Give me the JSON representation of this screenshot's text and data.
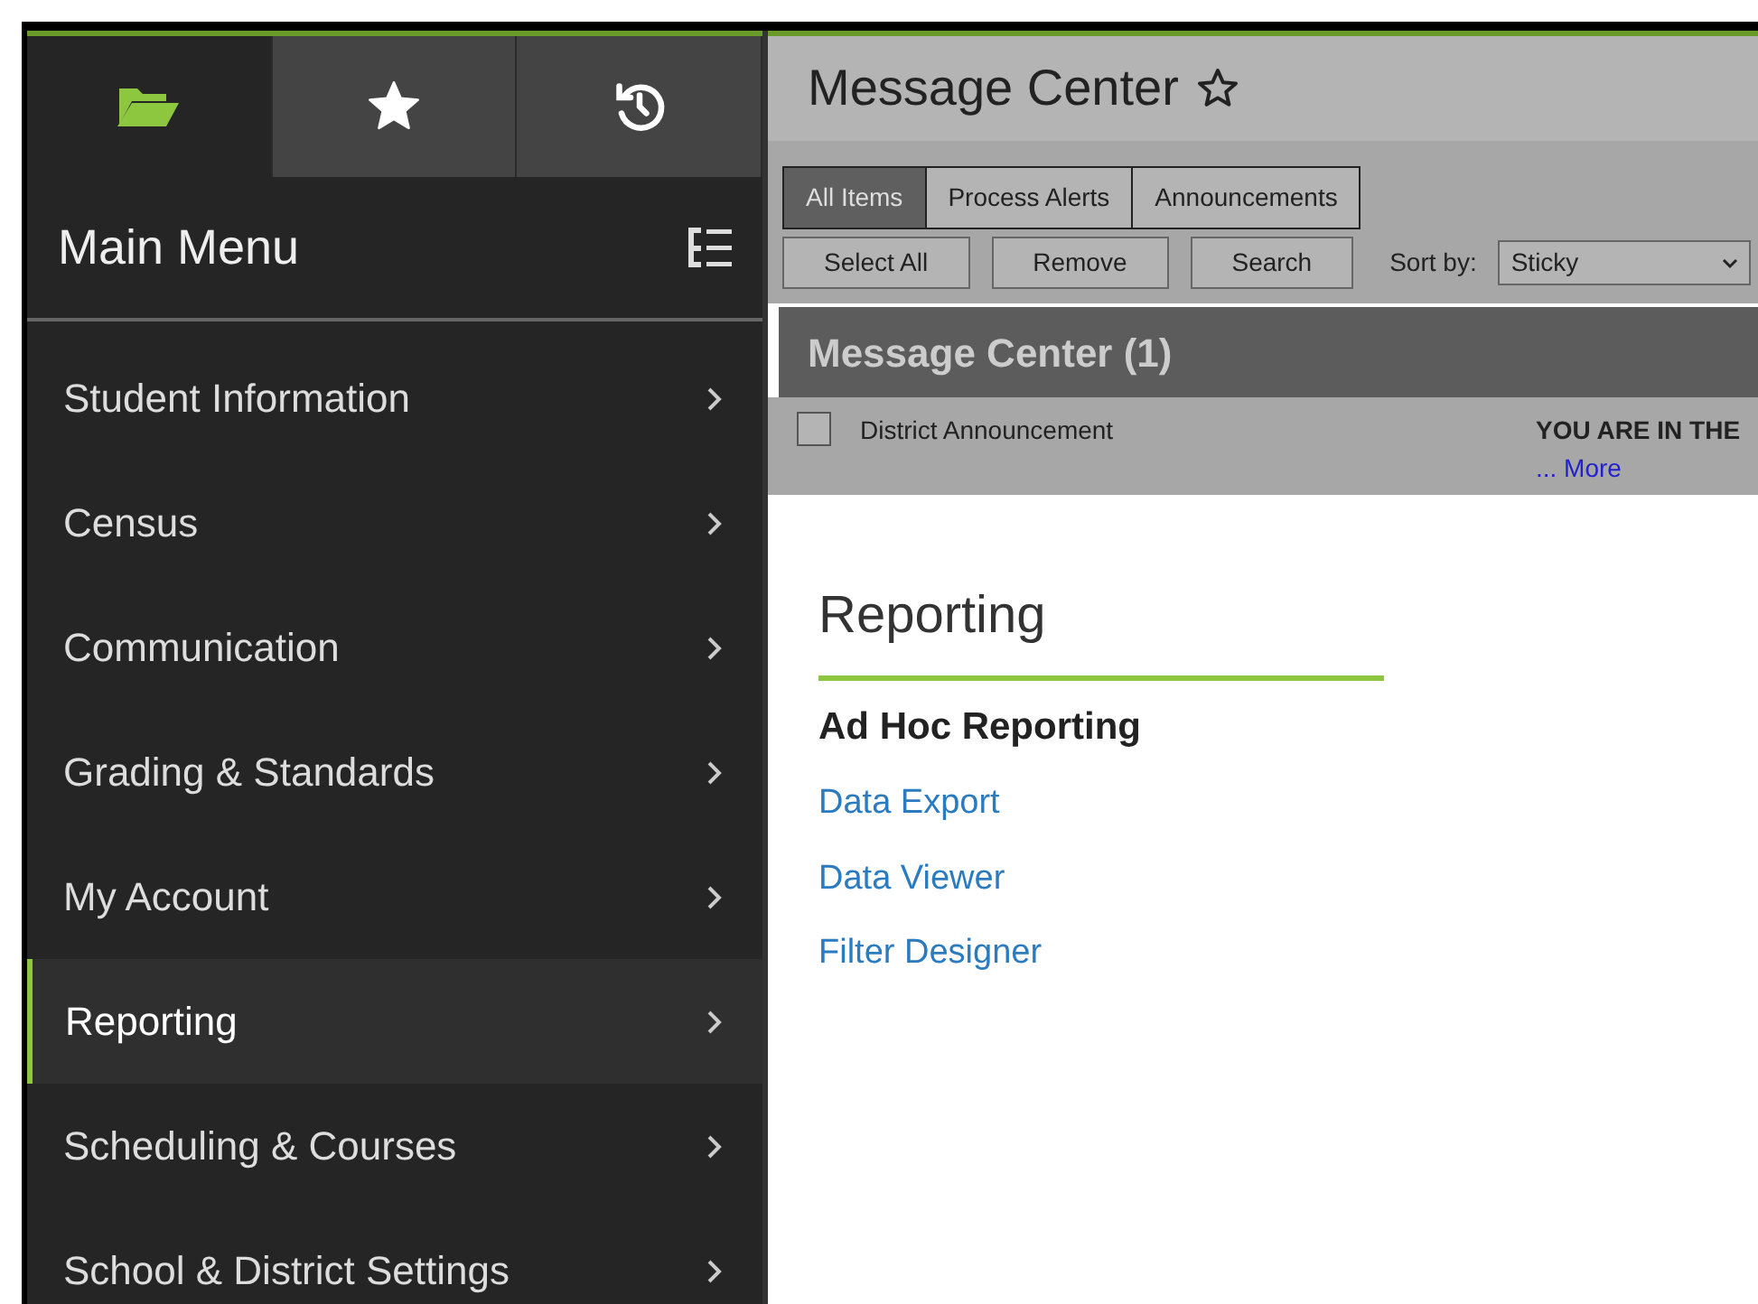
{
  "sidebar": {
    "tabs": [
      {
        "kind": "folder",
        "selected": true
      },
      {
        "kind": "star",
        "selected": false
      },
      {
        "kind": "history",
        "selected": false
      }
    ],
    "title": "Main Menu",
    "items": [
      {
        "label": "Student Information",
        "selected": false
      },
      {
        "label": "Census",
        "selected": false
      },
      {
        "label": "Communication",
        "selected": false
      },
      {
        "label": "Grading & Standards",
        "selected": false
      },
      {
        "label": "My Account",
        "selected": false
      },
      {
        "label": "Reporting",
        "selected": true
      },
      {
        "label": "Scheduling & Courses",
        "selected": false
      },
      {
        "label": "School & District Settings",
        "selected": false
      }
    ]
  },
  "message_center": {
    "title": "Message Center",
    "tabs": [
      {
        "label": "All Items",
        "selected": true
      },
      {
        "label": "Process Alerts",
        "selected": false
      },
      {
        "label": "Announcements",
        "selected": false
      }
    ],
    "buttons": [
      "Select All",
      "Remove",
      "Search"
    ],
    "sort_label": "Sort by:",
    "sort_value": "Sticky",
    "panel_title": "Message Center (1)",
    "messages": [
      {
        "checked": false,
        "title": "District Announcement",
        "preview": "YOU ARE IN THE",
        "more": "... More"
      }
    ]
  },
  "content": {
    "title": "Reporting",
    "section": "Ad Hoc Reporting",
    "links": [
      "Data Export",
      "Data Viewer",
      "Filter Designer"
    ]
  }
}
